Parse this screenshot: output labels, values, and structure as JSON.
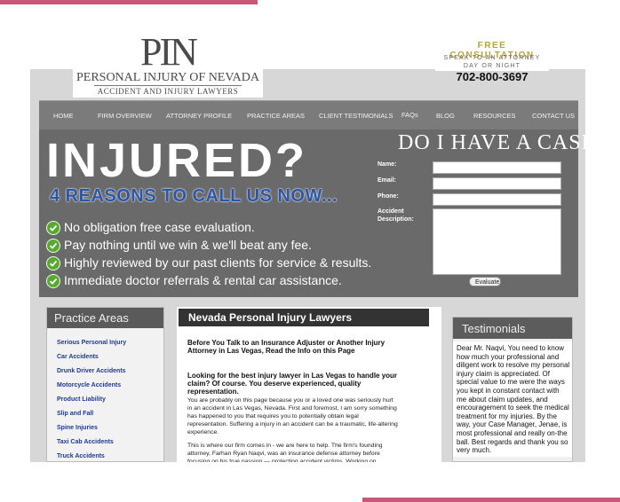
{
  "logo": {
    "monogram": "PIN",
    "line1": "PERSONAL INJURY OF NEVADA",
    "line2": "ACCIDENT AND INJURY LAWYERS"
  },
  "consult": {
    "title": "FREE CONSULTATION",
    "line1": "SPEAK TO AN ATTORNEY",
    "line2": "DAY OR NIGHT",
    "phone": "702-800-3697"
  },
  "nav": {
    "items": [
      "HOME",
      "FIRM OVERVIEW",
      "ATTORNEY PROFILE",
      "PRACTICE AREAS",
      "CLIENT TESTIMONIALS",
      "FAQs",
      "BLOG",
      "RESOURCES",
      "CONTACT US"
    ]
  },
  "hero": {
    "headline": "INJURED?",
    "subhead": "4 REASONS TO CALL US NOW...",
    "bullets": [
      "No obligation free case evaluation.",
      "Pay nothing until we win & we'll beat any fee.",
      "Highly reviewed by our past clients for service & results.",
      "Immediate doctor referrals & rental car assistance."
    ]
  },
  "case_form": {
    "title": "DO I HAVE A CASE?",
    "name_label": "Name:",
    "email_label": "Email:",
    "phone_label": "Phone:",
    "desc_label_1": "Accident",
    "desc_label_2": "Description:",
    "submit_label": "Evaluate"
  },
  "practice": {
    "heading": "Practice Areas",
    "items": [
      "Serious Personal Injury",
      "Car Accidents",
      "Drunk Driver Accidents",
      "Motorcycle Accidents",
      "Product Liability",
      "Slip and Fall",
      "Spine Injuries",
      "Taxi Cab Accidents",
      "Truck Accidents"
    ]
  },
  "main": {
    "heading": "Nevada Personal Injury Lawyers",
    "intro_heading": "Before You Talk to an Insurance Adjuster or Another Injury Attorney in Las Vegas, Read the Info on this Page",
    "sub_heading": "Looking for the best injury lawyer in Las Vegas to handle your claim? Of course. You deserve experienced, quality representation.",
    "para1": "You are probably on this page because you or a loved one was seriously hurt in an accident in Las Vegas, Nevada. First and foremost, I am sorry something has happened to you that requires you to potentially obtain legal representation. Suffering a injury in an accident can be a traumatic, life-altering experience.",
    "para2": "This is where our firm comes in - we are here to help. The firm's founding attorney, Farhan Ryan Naqvi, was an insurance defense attorney before focusing on his true passion — protecting accident victims. Working on"
  },
  "testimonials": {
    "heading": "Testimonials",
    "text": "Dear Mr. Naqvi, You need to know how much your professional and diligent work to resolve my personal injury claim is appreciated. Of special value to me were the ways you kept in constant contact with me about claim updates, and encouragement to seek the medical treatment for my injuries. By the way, your Case Manager, Jenae, is most professional and really on-the ball. Best regards and thank you so very much."
  },
  "colors": {
    "accent_pink": "#c9577a",
    "gold": "#b8a23c",
    "link_blue": "#1f3a8a",
    "check_green": "#5aa832"
  }
}
